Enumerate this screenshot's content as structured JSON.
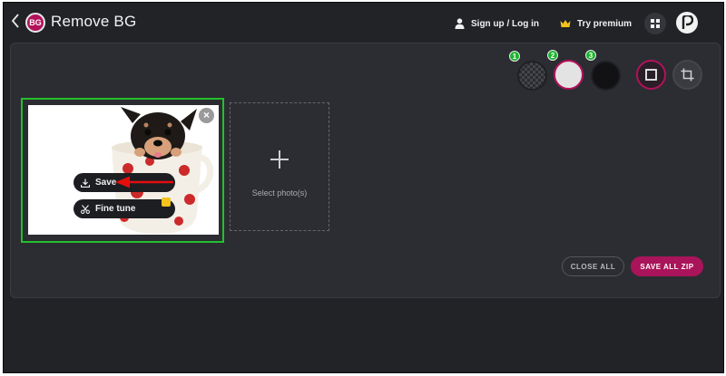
{
  "header": {
    "back_icon": "chevron-left-icon",
    "logo_text": "BG",
    "title": "Remove BG",
    "signup_label": "Sign up / Log in",
    "premium_label": "Try premium",
    "grid_icon": "grid-icon",
    "account_icon": "account-icon"
  },
  "colors": {
    "accent": "#b3125b",
    "highlight": "#22c02c",
    "background": "#222327",
    "panel": "#2c2d32",
    "crown": "#f4c21a"
  },
  "background_options": {
    "items": [
      {
        "badge": "1",
        "name": "transparent"
      },
      {
        "badge": "2",
        "name": "white"
      },
      {
        "badge": "3",
        "name": "black"
      }
    ],
    "selected": "white"
  },
  "photo": {
    "save_label": "Save",
    "fine_tune_label": "Fine tune"
  },
  "dropzone": {
    "label": "Select photo(s)"
  },
  "footer": {
    "close_all_label": "CLOSE ALL",
    "save_all_label": "SAVE ALL ZIP"
  }
}
